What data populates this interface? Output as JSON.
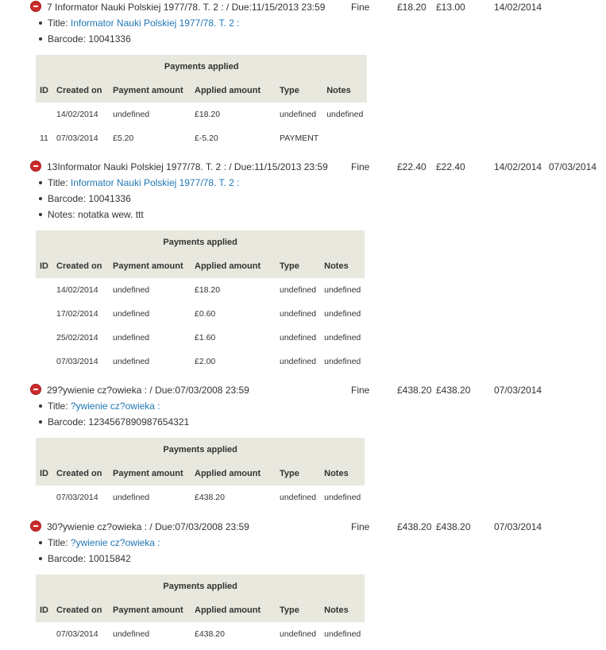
{
  "table_headers": {
    "caption": "Payments applied",
    "id": "ID",
    "created_on": "Created on",
    "payment_amount": "Payment amount",
    "applied_amount": "Applied amount",
    "type": "Type",
    "notes": "Notes"
  },
  "entries": [
    {
      "description": "7  Informator Nauki Polskiej 1977/78. T. 2 : / Due:11/15/2013 23:59",
      "account_type": "Fine",
      "amount": "£18.20",
      "outstanding": "£13.00",
      "date": "14/02/2014",
      "last_date": "",
      "title_label": "Title:",
      "title": "Informator Nauki Polskiej 1977/78. T. 2 :",
      "barcode": "Barcode: 10041336",
      "notes": "",
      "payments": [
        {
          "id": "",
          "created_on": "14/02/2014",
          "payment_amount": "undefined",
          "applied_amount": "£18.20",
          "type": "undefined",
          "notes": "undefined"
        },
        {
          "id": "11",
          "created_on": "07/03/2014",
          "payment_amount": "£5.20",
          "applied_amount": "£-5.20",
          "type": "PAYMENT",
          "notes": ""
        }
      ]
    },
    {
      "description": "13Informator Nauki Polskiej 1977/78. T. 2 : / Due:11/15/2013 23:59",
      "account_type": "Fine",
      "amount": "£22.40",
      "outstanding": "£22.40",
      "date": "14/02/2014",
      "last_date": "07/03/2014",
      "title_label": "Title:",
      "title": "Informator Nauki Polskiej 1977/78. T. 2 :",
      "barcode": "Barcode: 10041336",
      "notes": "Notes: notatka wew. ttt",
      "payments": [
        {
          "id": "",
          "created_on": "14/02/2014",
          "payment_amount": "undefined",
          "applied_amount": "£18.20",
          "type": "undefined",
          "notes": "undefined"
        },
        {
          "id": "",
          "created_on": "17/02/2014",
          "payment_amount": "undefined",
          "applied_amount": "£0.60",
          "type": "undefined",
          "notes": "undefined"
        },
        {
          "id": "",
          "created_on": "25/02/2014",
          "payment_amount": "undefined",
          "applied_amount": "£1.60",
          "type": "undefined",
          "notes": "undefined"
        },
        {
          "id": "",
          "created_on": "07/03/2014",
          "payment_amount": "undefined",
          "applied_amount": "£2.00",
          "type": "undefined",
          "notes": "undefined"
        }
      ]
    },
    {
      "description": "29?ywienie cz?owieka : / Due:07/03/2008 23:59",
      "account_type": "Fine",
      "amount": "£438.20",
      "outstanding": "£438.20",
      "date": "07/03/2014",
      "last_date": "",
      "title_label": "Title:",
      "title": "?ywienie cz?owieka :",
      "barcode": "Barcode: 1234567890987654321",
      "notes": "",
      "payments": [
        {
          "id": "",
          "created_on": "07/03/2014",
          "payment_amount": "undefined",
          "applied_amount": "£438.20",
          "type": "undefined",
          "notes": "undefined"
        }
      ]
    },
    {
      "description": "30?ywienie cz?owieka : / Due:07/03/2008 23:59",
      "account_type": "Fine",
      "amount": "£438.20",
      "outstanding": "£438.20",
      "date": "07/03/2014",
      "last_date": "",
      "title_label": "Title:",
      "title": "?ywienie cz?owieka :",
      "barcode": "Barcode: 10015842",
      "notes": "",
      "payments": [
        {
          "id": "",
          "created_on": "07/03/2014",
          "payment_amount": "undefined",
          "applied_amount": "£438.20",
          "type": "undefined",
          "notes": "undefined"
        }
      ]
    }
  ],
  "icons": {
    "remove": "remove-circle-icon"
  },
  "colors": {
    "link": "#1f77b4",
    "remove_icon": "#cc2b2b",
    "table_header_bg": "#e8e8de"
  }
}
